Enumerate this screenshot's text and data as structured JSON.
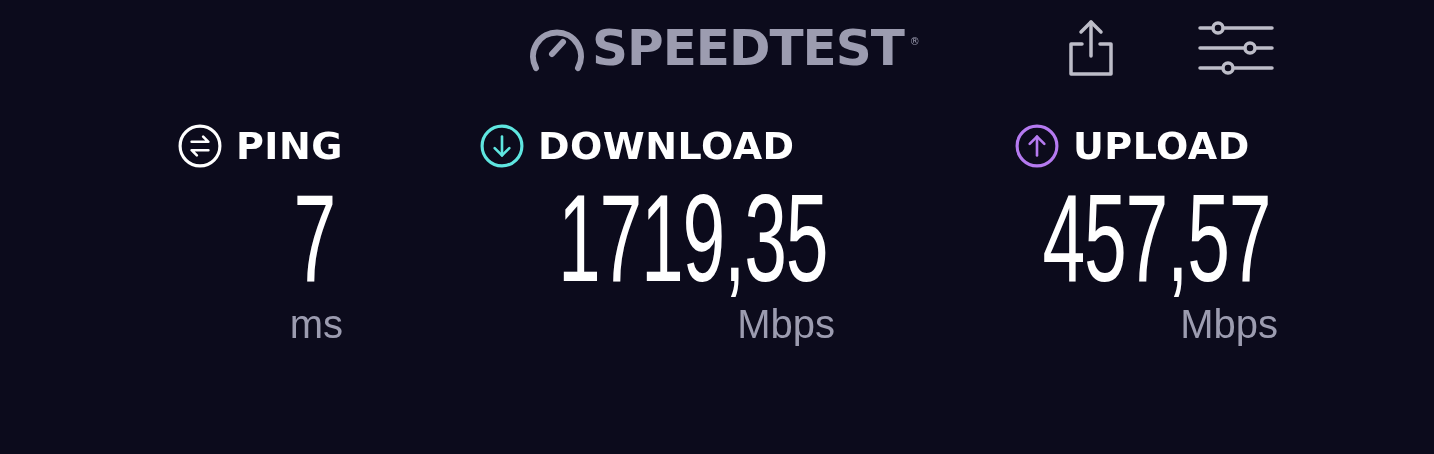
{
  "header": {
    "logo": "SPEEDTEST",
    "registered": "®"
  },
  "metrics": [
    {
      "kind": "ping",
      "label": "PING",
      "value": "7",
      "unit": "ms",
      "color": "#ffffff"
    },
    {
      "kind": "download",
      "label": "DOWNLOAD",
      "value": "1719,35",
      "unit": "Mbps",
      "color": "#5fe6e0"
    },
    {
      "kind": "upload",
      "label": "UPLOAD",
      "value": "457,57",
      "unit": "Mbps",
      "color": "#b57af0"
    }
  ]
}
